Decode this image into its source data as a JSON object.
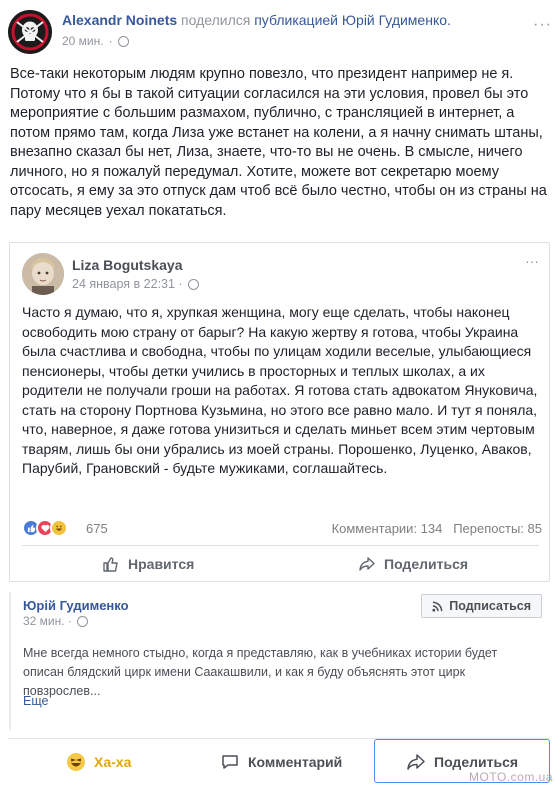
{
  "header": {
    "author": "Alexandr Noinets",
    "action": "поделился",
    "target": "публикацией Юрій Гудименко.",
    "time": "20 мин.",
    "dots": "···"
  },
  "post": {
    "text": "Все-таки некоторым людям крупно повезло, что президент например не я. Потому что я бы в такой ситуации согласился на эти условия, провел бы это мероприятие с большим размахом, публично, с трансляцией в интернет, а потом прямо там, когда Лиза уже встанет на колени, а я начну снимать штаны, внезапно сказал бы нет, Лиза, знаете, что-то вы не очень. В смысле, ничего личного, но я пожалуй передумал. Хотите, можете вот секретарю моему отсосать, я ему за это отпуск дам чтоб всё было честно, чтобы он из страны на пару месяцев уехал покататься."
  },
  "shared": {
    "name": "Liza Bogutskaya",
    "time": "24 января в 22:31 ·",
    "dots": "···",
    "text": "Часто я думаю, что я, хрупкая женщина, могу еще сделать, чтобы наконец освободить мою страну от барыг? На какую жертву я готова, чтобы Украина была счастлива и свободна, чтобы по улицам ходили веселые, улыбающиеся пенсионеры, чтобы детки учились в просторных и теплых школах, а их родители не получали гроши на работах. Я готова стать адвокатом Януковича, стать на сторону Портнова Кузьмина, но этого все равно мало. И тут я поняла, что, наверное, я даже готова унизиться и сделать миньет всем этим чертовым тварям, лишь бы они убрались из моей страны. Порошенко, Луценко, Аваков, Парубий, Грановский - будьте мужиками, соглашайтесь.",
    "reactions_count": "675",
    "comments": "Комментарии: 134",
    "shares": "Перепосты: 85",
    "like_label": "Нравится",
    "share_label": "Поделиться"
  },
  "page": {
    "name": "Юрій Гудименко",
    "time": "32 мин. ·",
    "subscribe_label": "Подписаться",
    "text": "Мне всегда немного стыдно, когда я представляю, как в учебниках истории будет описан блядский цирк имени Саакашвили, и как я буду объяснять этот цирк повзрослев...",
    "more": "Еще"
  },
  "actions": {
    "haha_label": "Ха-ха",
    "comment_label": "Комментарий",
    "share_label": "Поделиться"
  },
  "watermark": "MOTO.com.ua",
  "colors": {
    "link": "#365899",
    "haha": "#e0a800",
    "like": "#4a7cd6",
    "love": "#e8435a"
  },
  "icons": [
    "skull-avatar",
    "globe-icon",
    "like-reaction-icon",
    "love-reaction-icon",
    "haha-reaction-icon",
    "thumbs-up-icon",
    "share-arrow-icon",
    "rss-icon",
    "comment-bubble-icon"
  ]
}
